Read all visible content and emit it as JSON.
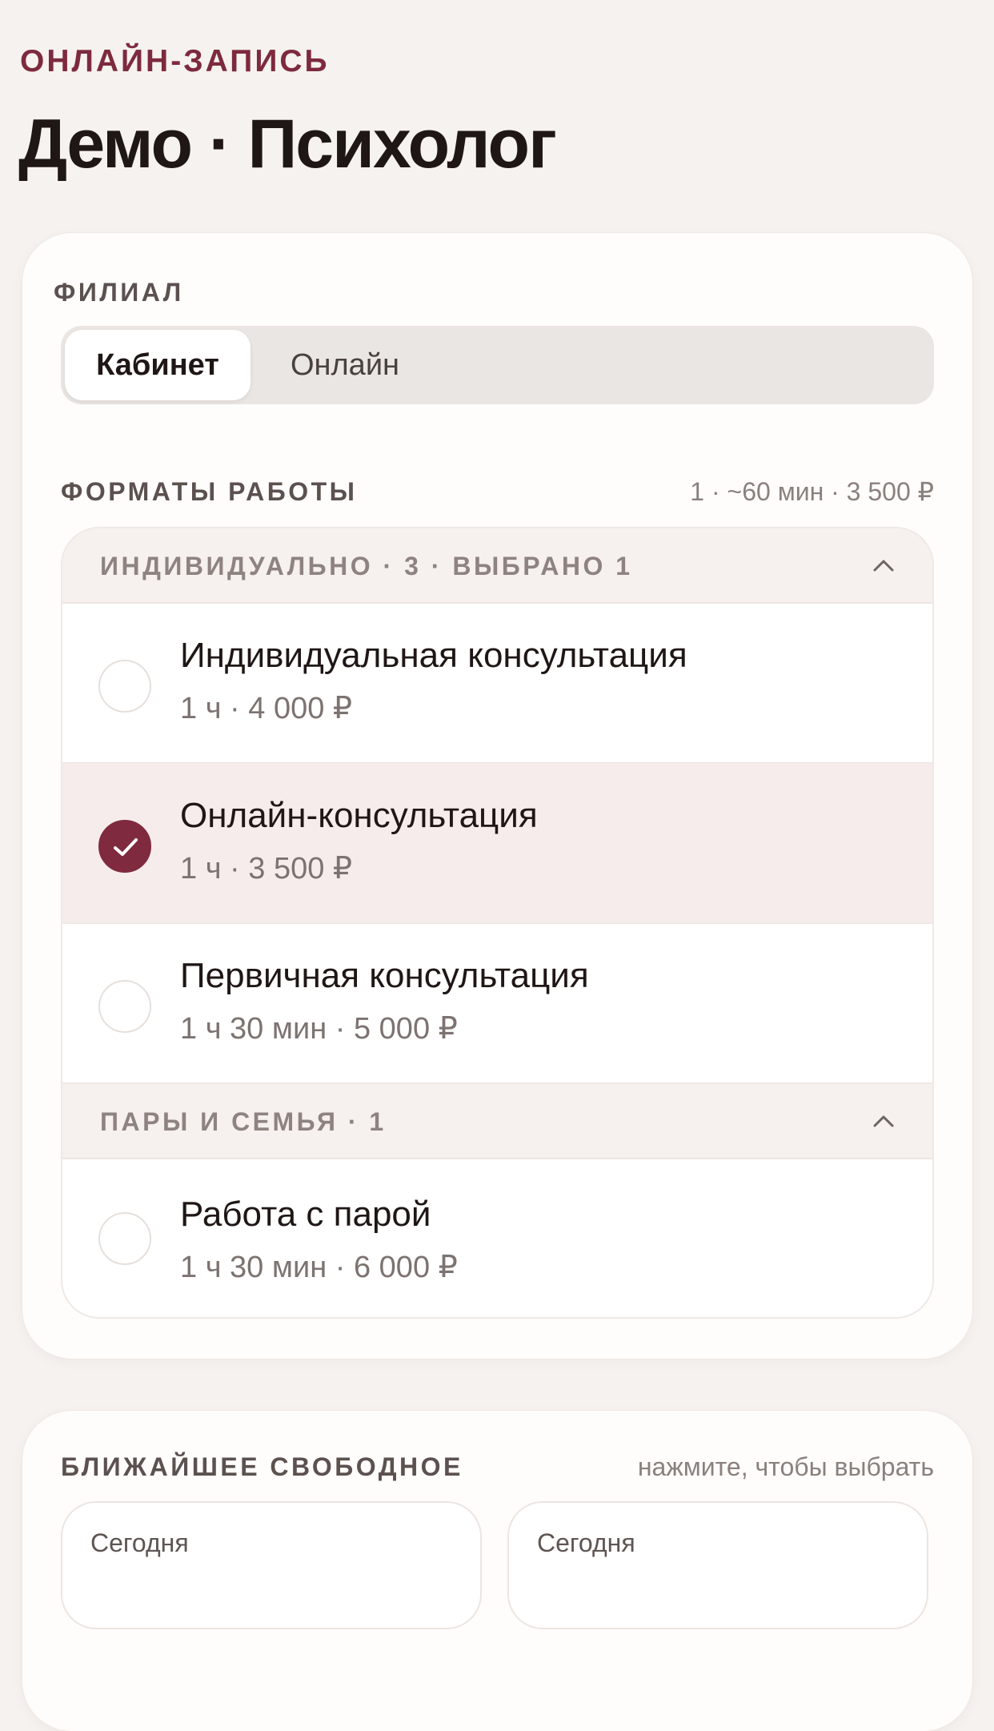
{
  "header": {
    "eyebrow": "ОНЛАЙН-ЗАПИСЬ",
    "title": "Демо · Психолог"
  },
  "branch": {
    "label": "ФИЛИАЛ",
    "options": [
      "Кабинет",
      "Онлайн"
    ],
    "selected": "Кабинет"
  },
  "formats": {
    "label": "ФОРМАТЫ РАБОТЫ",
    "summary": "1 · ~60 мин · 3 500 ₽",
    "groups": [
      {
        "title": "ИНДИВИДУАЛЬНО · 3 · ВЫБРАНО 1",
        "expanded": true,
        "items": [
          {
            "name": "Индивидуальная консультация",
            "details": "1 ч · 4 000 ₽",
            "selected": false
          },
          {
            "name": "Онлайн-консультация",
            "details": "1 ч · 3 500 ₽",
            "selected": true
          },
          {
            "name": "Первичная консультация",
            "details": "1 ч 30 мин · 5 000 ₽",
            "selected": false
          }
        ]
      },
      {
        "title": "ПАРЫ И СЕМЬЯ · 1",
        "expanded": true,
        "items": [
          {
            "name": "Работа с парой",
            "details": "1 ч 30 мин · 6 000 ₽",
            "selected": false
          }
        ]
      }
    ]
  },
  "nearest": {
    "label": "БЛИЖАЙШЕЕ СВОБОДНОЕ",
    "hint": "нажмите, чтобы выбрать",
    "slots": [
      {
        "day": "Сегодня"
      },
      {
        "day": "Сегодня"
      }
    ]
  },
  "icons": {
    "collapse": "chevron-up-icon",
    "check": "check-icon"
  },
  "colors": {
    "accent": "#7f2a3f",
    "background": "#f6f2ef",
    "selected_row": "#f6ecec"
  }
}
